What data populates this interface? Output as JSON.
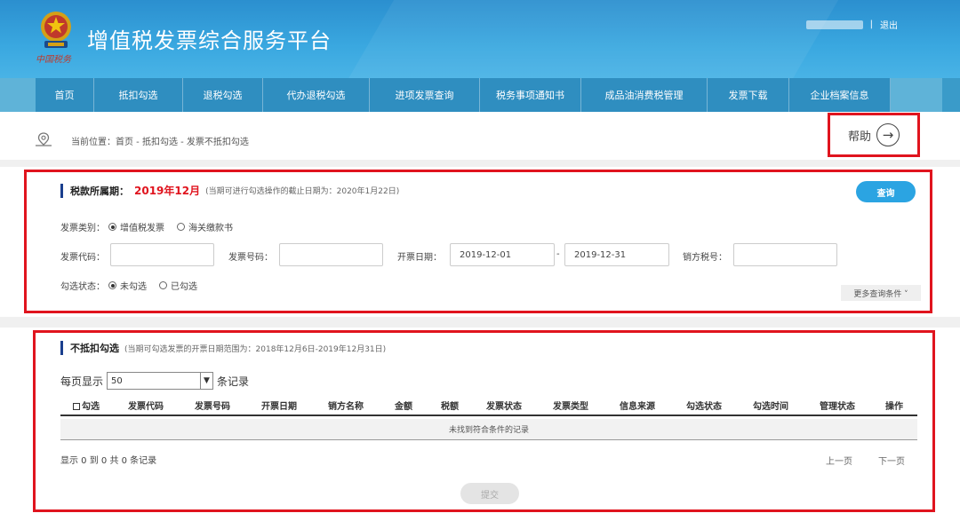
{
  "header": {
    "title": "增值税发票综合服务平台",
    "seal_text": "中国税务",
    "logout": "退出",
    "separator": "|",
    "brand_color": "#2b8fcf"
  },
  "nav": {
    "items": [
      {
        "label": "首页"
      },
      {
        "label": "抵扣勾选"
      },
      {
        "label": "退税勾选"
      },
      {
        "label": "代办退税勾选"
      },
      {
        "label": "进项发票查询"
      },
      {
        "label": "税务事项通知书"
      },
      {
        "label": "成品油消费税管理"
      },
      {
        "label": "发票下载"
      },
      {
        "label": "企业档案信息"
      }
    ]
  },
  "breadcrumb": {
    "text": "当前位置：首页 - 抵扣勾选 - 发票不抵扣勾选",
    "help_label": "帮助"
  },
  "query": {
    "period_label": "税款所属期：",
    "period_value": "2019年12月",
    "period_note": "(当期可进行勾选操作的截止日期为：2020年1月22日)",
    "query_button": "查询",
    "invoice_type_label": "发票类别：",
    "invoice_type_options": [
      "增值税发票",
      "海关缴款书"
    ],
    "invoice_type_selected": "增值税发票",
    "invoice_code_label": "发票代码：",
    "invoice_code_value": "",
    "invoice_number_label": "发票号码：",
    "invoice_number_value": "",
    "issue_date_label": "开票日期：",
    "date_from": "2019-12-01",
    "date_sep": "-",
    "date_to": "2019-12-31",
    "seller_tax_label": "销方税号：",
    "seller_tax_value": "",
    "check_status_label": "勾选状态：",
    "check_status_options": [
      "未勾选",
      "已勾选"
    ],
    "check_status_selected": "未勾选",
    "more_conditions": "更多查询条件 ˅"
  },
  "results": {
    "title": "不抵扣勾选",
    "note": "(当期可勾选发票的开票日期范围为：2018年12月6日-2019年12月31日)",
    "per_page_label": "每页显示",
    "per_page_value": "50",
    "per_page_suffix": "条记录",
    "columns": [
      "勾选",
      "发票代码",
      "发票号码",
      "开票日期",
      "销方名称",
      "金额",
      "税额",
      "发票状态",
      "发票类型",
      "信息来源",
      "勾选状态",
      "勾选时间",
      "管理状态",
      "操作"
    ],
    "empty_message": "未找到符合条件的记录",
    "showing": "显示 0 到 0 共 0 条记录",
    "prev_page": "上一页",
    "next_page": "下一页",
    "submit": "提交"
  }
}
